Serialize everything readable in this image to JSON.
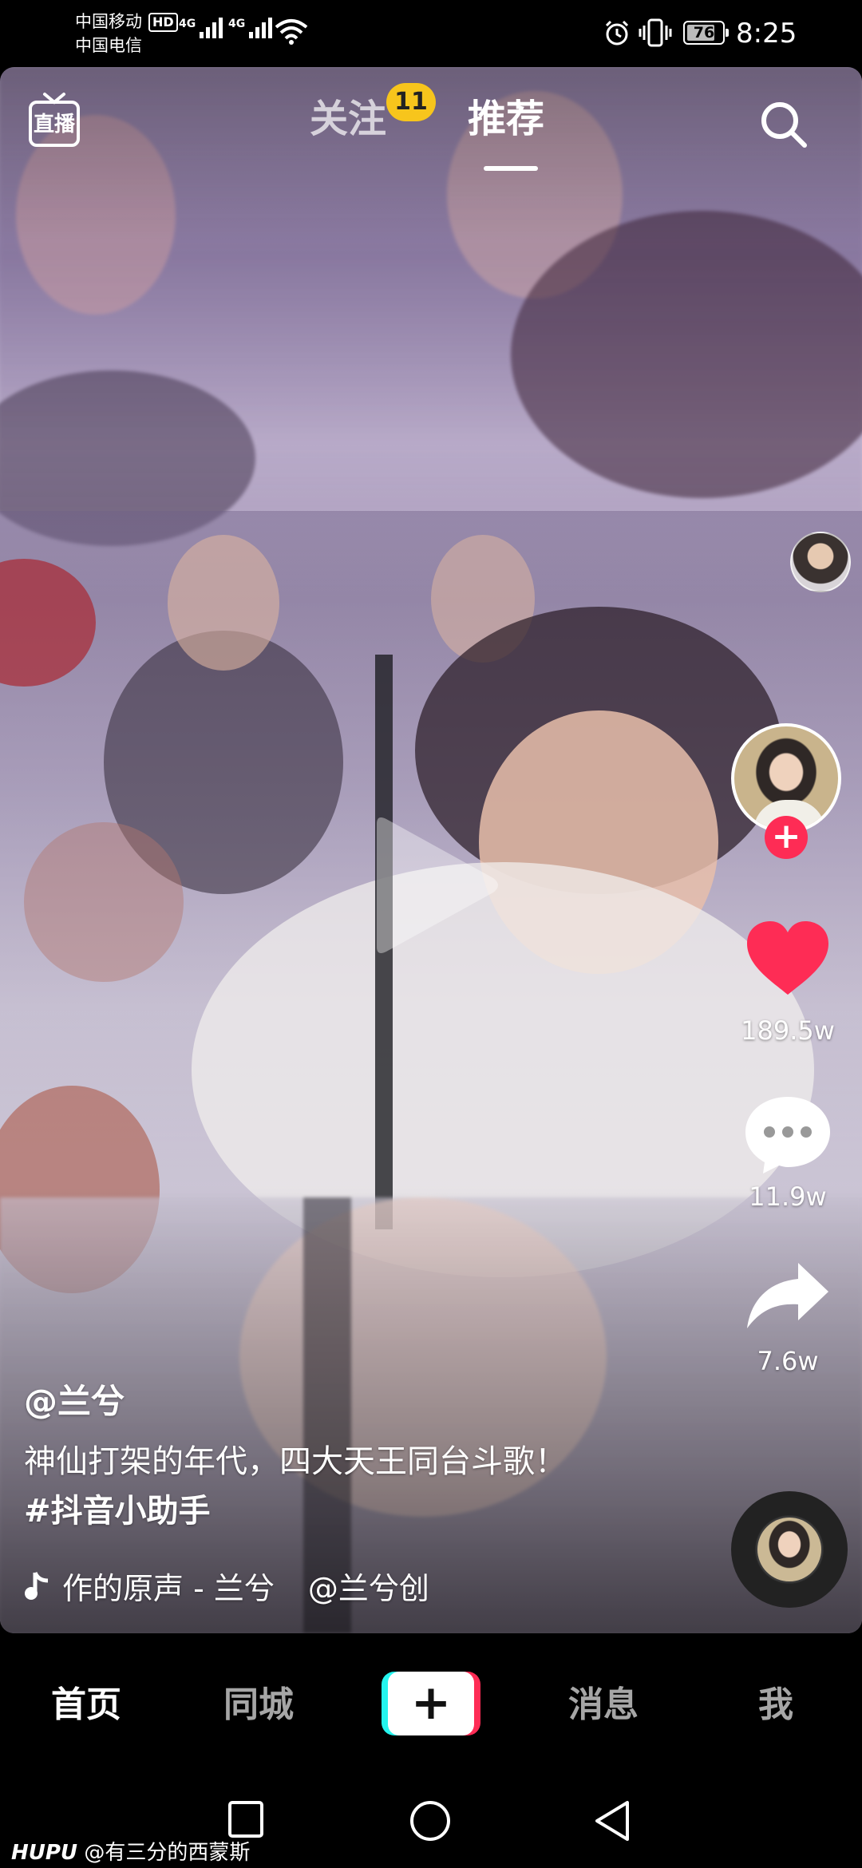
{
  "status_bar": {
    "carrier_1": "中国移动",
    "carrier_2": "中国电信",
    "hd": "HD",
    "net_1": "4G",
    "net_2": "4G",
    "battery": "76",
    "time": "8:25"
  },
  "top_nav": {
    "live_icon": "live-tv-icon",
    "live_label": "直播",
    "tabs": [
      {
        "label": "关注",
        "badge": "11",
        "active": false
      },
      {
        "label": "推荐",
        "active": true
      }
    ],
    "search_icon": "search-icon"
  },
  "video": {
    "play_icon": "play-icon",
    "author_handle": "@兰兮",
    "description": "神仙打架的年代，四大天王同台斗歌！",
    "hashtag": "#抖音小助手",
    "music_icon": "music-note-icon",
    "music_text": "作的原声 - 兰兮",
    "music_credit": "@兰兮创"
  },
  "rail": {
    "follow_plus": "+",
    "like_icon": "heart-icon",
    "likes": "189.5w",
    "comment_icon": "comment-bubble-icon",
    "comments": "11.9w",
    "share_icon": "share-arrow-icon",
    "shares": "7.6w"
  },
  "bottom_tabs": {
    "home": "首页",
    "nearby": "同城",
    "create": "+",
    "messages": "消息",
    "me": "我"
  },
  "system_nav": {
    "recents": "square-recents-icon",
    "home": "circle-home-icon",
    "back": "triangle-back-icon"
  },
  "watermark": {
    "brand": "HUPU",
    "handle": "@有三分的西蒙斯"
  },
  "colors": {
    "like": "#fe2c55",
    "badge": "#f7c51c",
    "create_cyan": "#25f4ee",
    "create_red": "#fe2c55"
  }
}
